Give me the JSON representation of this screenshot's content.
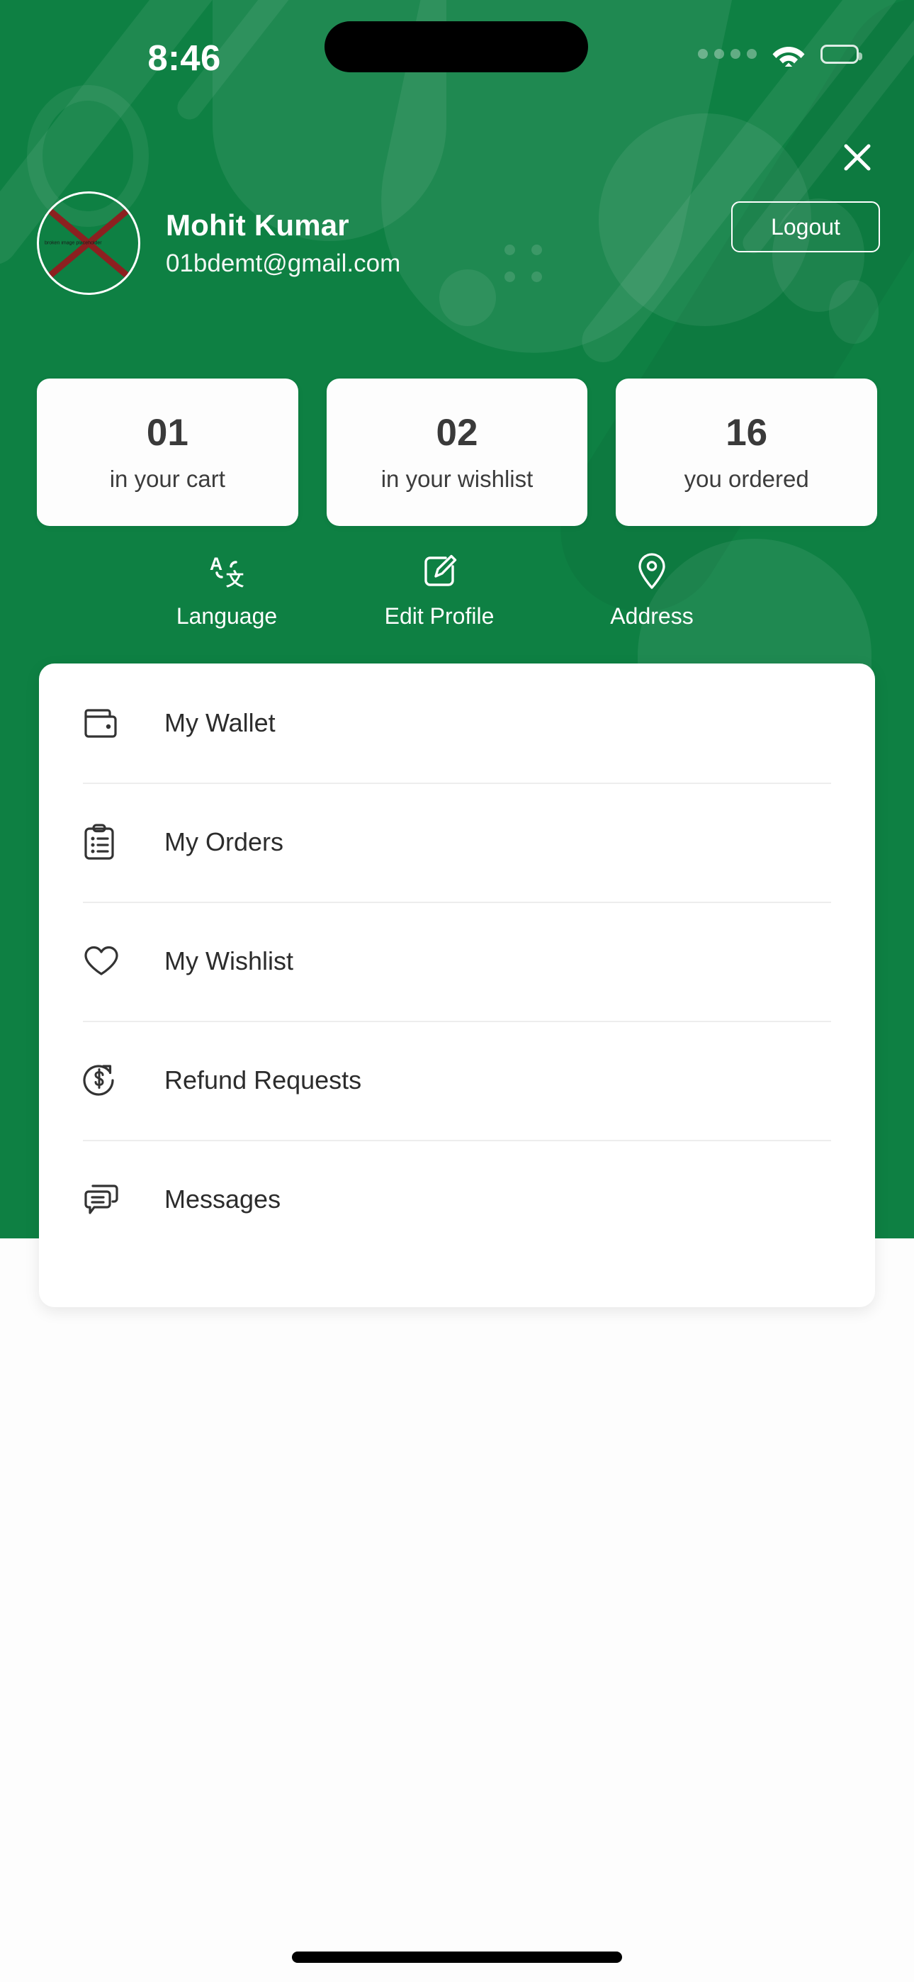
{
  "status_bar": {
    "time": "8:46",
    "signal_icon": "signal-dots-icon",
    "wifi_icon": "wifi-icon",
    "battery_icon": "battery-full-icon"
  },
  "header": {
    "close_icon": "close-icon",
    "logout_label": "Logout",
    "accent_green": "#0E8043"
  },
  "profile": {
    "avatar_icon": "broken-image-avatar-icon",
    "avatar_alt_text": "broken image placeholder",
    "name": "Mohit Kumar",
    "email": "01bdemt@gmail.com"
  },
  "stats": [
    {
      "value": "01",
      "label": "in your cart"
    },
    {
      "value": "02",
      "label": "in your wishlist"
    },
    {
      "value": "16",
      "label": "you ordered"
    }
  ],
  "actions": [
    {
      "label": "Language",
      "icon": "translate-icon"
    },
    {
      "label": "Edit Profile",
      "icon": "edit-pencil-icon"
    },
    {
      "label": "Address",
      "icon": "map-pin-icon"
    }
  ],
  "menu": [
    {
      "label": "My Wallet",
      "icon": "wallet-icon"
    },
    {
      "label": "My Orders",
      "icon": "clipboard-list-icon"
    },
    {
      "label": "My Wishlist",
      "icon": "heart-icon"
    },
    {
      "label": "Refund Requests",
      "icon": "refund-dollar-icon"
    },
    {
      "label": "Messages",
      "icon": "chat-bubbles-icon"
    }
  ]
}
